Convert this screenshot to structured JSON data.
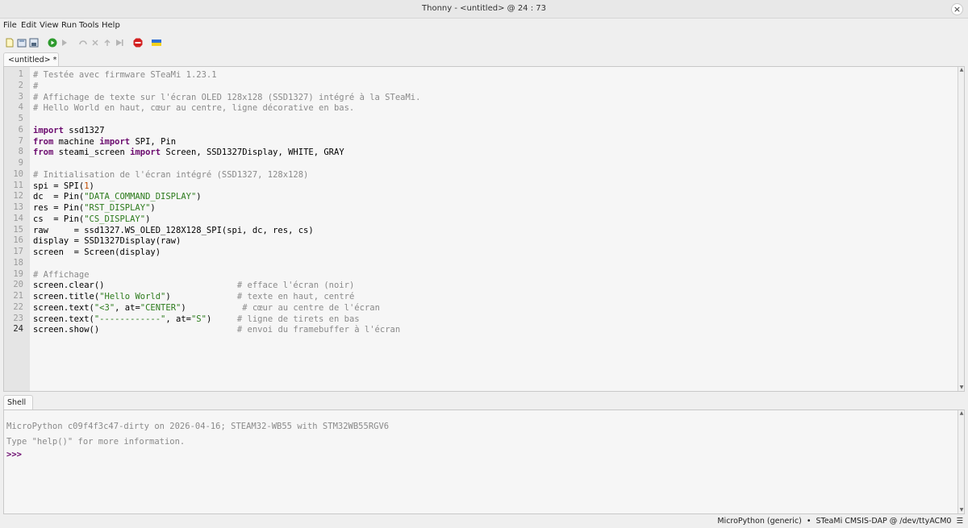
{
  "window": {
    "title": "Thonny  -  <untitled>  @  24 : 73",
    "close": "×"
  },
  "menu": [
    "File",
    "Edit",
    "View",
    "Run",
    "Tools",
    "Help"
  ],
  "editor": {
    "tab_label": "<untitled> *",
    "current_line": 24,
    "lines": [
      [
        [
          "c",
          "# Testée avec firmware STeaMi 1.23.1"
        ]
      ],
      [
        [
          "c",
          "#"
        ]
      ],
      [
        [
          "c",
          "# Affichage de texte sur l'écran OLED 128x128 (SSD1327) intégré à la STeaMi."
        ]
      ],
      [
        [
          "c",
          "# Hello World en haut, cœur au centre, ligne décorative en bas."
        ]
      ],
      [],
      [
        [
          "k",
          "import"
        ],
        [
          "t",
          " ssd1327"
        ]
      ],
      [
        [
          "k",
          "from"
        ],
        [
          "t",
          " machine "
        ],
        [
          "k",
          "import"
        ],
        [
          "t",
          " SPI, Pin"
        ]
      ],
      [
        [
          "k",
          "from"
        ],
        [
          "t",
          " steami_screen "
        ],
        [
          "k",
          "import"
        ],
        [
          "t",
          " Screen, SSD1327Display, WHITE, GRAY"
        ]
      ],
      [],
      [
        [
          "c",
          "# Initialisation de l'écran intégré (SSD1327, 128x128)"
        ]
      ],
      [
        [
          "t",
          "spi = SPI("
        ],
        [
          "n",
          "1"
        ],
        [
          "t",
          ")"
        ]
      ],
      [
        [
          "t",
          "dc  = Pin("
        ],
        [
          "s",
          "\"DATA_COMMAND_DISPLAY\""
        ],
        [
          "t",
          ")"
        ]
      ],
      [
        [
          "t",
          "res = Pin("
        ],
        [
          "s",
          "\"RST_DISPLAY\""
        ],
        [
          "t",
          ")"
        ]
      ],
      [
        [
          "t",
          "cs  = Pin("
        ],
        [
          "s",
          "\"CS_DISPLAY\""
        ],
        [
          "t",
          ")"
        ]
      ],
      [
        [
          "t",
          "raw     = ssd1327.WS_OLED_128X128_SPI(spi, dc, res, cs)"
        ]
      ],
      [
        [
          "t",
          "display = SSD1327Display(raw)"
        ]
      ],
      [
        [
          "t",
          "screen  = Screen(display)"
        ]
      ],
      [],
      [
        [
          "c",
          "# Affichage"
        ]
      ],
      [
        [
          "t",
          "screen.clear()                          "
        ],
        [
          "c",
          "# efface l'écran (noir)"
        ]
      ],
      [
        [
          "t",
          "screen.title("
        ],
        [
          "s",
          "\"Hello World\""
        ],
        [
          "t",
          ")             "
        ],
        [
          "c",
          "# texte en haut, centré"
        ]
      ],
      [
        [
          "t",
          "screen.text("
        ],
        [
          "s",
          "\"<3\""
        ],
        [
          "t",
          ", at="
        ],
        [
          "s",
          "\"CENTER\""
        ],
        [
          "t",
          ")           "
        ],
        [
          "c",
          "# cœur au centre de l'écran"
        ]
      ],
      [
        [
          "t",
          "screen.text("
        ],
        [
          "s",
          "\"------------\""
        ],
        [
          "t",
          ", at="
        ],
        [
          "s",
          "\"S\""
        ],
        [
          "t",
          ")     "
        ],
        [
          "c",
          "# ligne de tirets en bas"
        ]
      ],
      [
        [
          "t",
          "screen.show()                           "
        ],
        [
          "c",
          "# envoi du framebuffer à l'écran"
        ]
      ]
    ]
  },
  "shell": {
    "tab_label": "Shell",
    "banner": "MicroPython c09f4f3c47-dirty on 2026-04-16; STEAM32-WB55 with STM32WB55RGV6",
    "help_text": "Type \"help()\" for more information.",
    "prompt": ">>>"
  },
  "status": {
    "text": "MicroPython (generic)  •  STeaMi CMSIS-DAP @ /dev/ttyACM0  ☰"
  },
  "icons": [
    "new-file-icon",
    "open-file-icon",
    "save-file-icon",
    "run-icon",
    "debug-icon",
    "step-over-icon",
    "step-into-icon",
    "step-out-icon",
    "resume-icon",
    "stop-icon",
    "ukraine-flag-icon"
  ],
  "colors": {
    "keyword": "#6b0a6e",
    "string": "#2b7a1b",
    "comment": "#8a8a8a",
    "number": "#c24b00",
    "run": "#2e9b2e",
    "stop": "#d32020"
  }
}
